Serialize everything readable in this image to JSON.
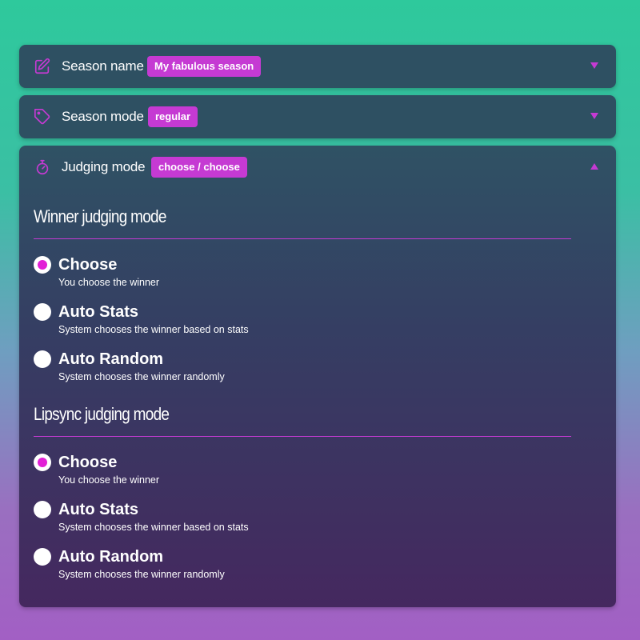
{
  "colors": {
    "accent": "#c53ad3",
    "radio_checked": "#e21fd6",
    "panel": "#2e5062"
  },
  "panels": [
    {
      "title": "Season name",
      "badge": "My fabulous season",
      "icon": "edit-icon",
      "expanded": false
    },
    {
      "title": "Season mode",
      "badge": "regular",
      "icon": "tag-icon",
      "expanded": false
    },
    {
      "title": "Judging mode",
      "badge": "choose / choose",
      "icon": "stopwatch-icon",
      "expanded": true
    }
  ],
  "judging": {
    "winner": {
      "title": "Winner judging mode",
      "options": [
        {
          "label": "Choose",
          "desc": "You choose the winner",
          "checked": true
        },
        {
          "label": "Auto Stats",
          "desc": "System chooses the winner based on stats",
          "checked": false
        },
        {
          "label": "Auto Random",
          "desc": "System chooses the winner randomly",
          "checked": false
        }
      ]
    },
    "lipsync": {
      "title": "Lipsync judging mode",
      "options": [
        {
          "label": "Choose",
          "desc": "You choose the winner",
          "checked": true
        },
        {
          "label": "Auto Stats",
          "desc": "System chooses the winner based on stats",
          "checked": false
        },
        {
          "label": "Auto Random",
          "desc": "System chooses the winner randomly",
          "checked": false
        }
      ]
    }
  }
}
